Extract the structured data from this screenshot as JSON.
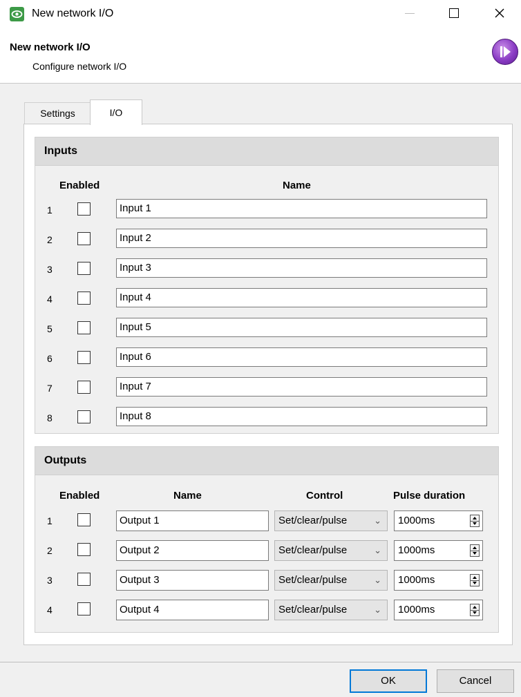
{
  "window": {
    "title": "New network I/O"
  },
  "header": {
    "title": "New network I/O",
    "subtitle": "Configure network I/O"
  },
  "tabs": [
    {
      "label": "Settings",
      "active": false
    },
    {
      "label": "I/O",
      "active": true
    }
  ],
  "inputs": {
    "title": "Inputs",
    "col_enabled": "Enabled",
    "col_name": "Name",
    "rows": [
      {
        "num": "1",
        "enabled": false,
        "name": "Input 1"
      },
      {
        "num": "2",
        "enabled": false,
        "name": "Input 2"
      },
      {
        "num": "3",
        "enabled": false,
        "name": "Input 3"
      },
      {
        "num": "4",
        "enabled": false,
        "name": "Input 4"
      },
      {
        "num": "5",
        "enabled": false,
        "name": "Input 5"
      },
      {
        "num": "6",
        "enabled": false,
        "name": "Input 6"
      },
      {
        "num": "7",
        "enabled": false,
        "name": "Input 7"
      },
      {
        "num": "8",
        "enabled": false,
        "name": "Input 8"
      }
    ]
  },
  "outputs": {
    "title": "Outputs",
    "col_enabled": "Enabled",
    "col_name": "Name",
    "col_control": "Control",
    "col_pulse": "Pulse duration",
    "rows": [
      {
        "num": "1",
        "enabled": false,
        "name": "Output 1",
        "control": "Set/clear/pulse",
        "pulse": "1000ms"
      },
      {
        "num": "2",
        "enabled": false,
        "name": "Output 2",
        "control": "Set/clear/pulse",
        "pulse": "1000ms"
      },
      {
        "num": "3",
        "enabled": false,
        "name": "Output 3",
        "control": "Set/clear/pulse",
        "pulse": "1000ms"
      },
      {
        "num": "4",
        "enabled": false,
        "name": "Output 4",
        "control": "Set/clear/pulse",
        "pulse": "1000ms"
      }
    ]
  },
  "buttons": {
    "ok": "OK",
    "cancel": "Cancel"
  },
  "colors": {
    "app_icon": "#3d9a47",
    "logo": "#8a3cc4",
    "ok_border": "#0078d7"
  }
}
